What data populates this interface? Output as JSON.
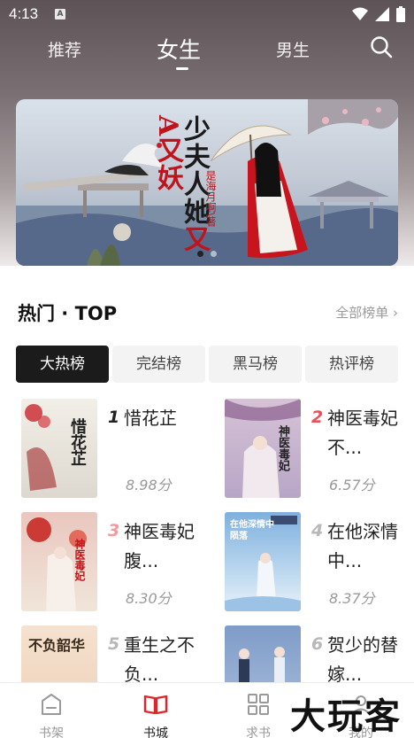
{
  "status_bar": {
    "time": "4:13",
    "notification_icon": "A"
  },
  "top_nav": {
    "tabs": [
      {
        "label": "推荐"
      },
      {
        "label": "女生"
      },
      {
        "label": "男生"
      }
    ],
    "active_tab": "女生"
  },
  "banner": {
    "title_black": "少夫人她",
    "title_red": "又A又妖",
    "author": "是海月啊\\著",
    "slide_count": 2,
    "active_slide": 1
  },
  "hot": {
    "title": "热门 · TOP",
    "all_link": "全部榜单",
    "rank_tabs": [
      {
        "label": "大热榜"
      },
      {
        "label": "完结榜"
      },
      {
        "label": "黑马榜"
      },
      {
        "label": "热评榜"
      }
    ],
    "books": [
      {
        "rank": "1",
        "name": "惜花芷",
        "score": "8.98分",
        "cover_text": "惜花芷"
      },
      {
        "rank": "2",
        "name": "神医毒妃不...",
        "score": "6.57分",
        "cover_text": "神医毒妃"
      },
      {
        "rank": "3",
        "name": "神医毒妃腹...",
        "score": "8.30分",
        "cover_text": "神医毒妃"
      },
      {
        "rank": "4",
        "name": "在他深情中...",
        "score": "8.37分",
        "cover_text": "在他深情中陨落"
      },
      {
        "rank": "5",
        "name": "重生之不负...",
        "score": "",
        "cover_text": "不负韶华"
      },
      {
        "rank": "6",
        "name": "贺少的替嫁...",
        "score": "",
        "cover_text": ""
      }
    ]
  },
  "bottom_nav": {
    "items": [
      {
        "label": "书架",
        "icon": "bookshelf-icon"
      },
      {
        "label": "书城",
        "icon": "open-book-icon"
      },
      {
        "label": "求书",
        "icon": "grid-icon"
      },
      {
        "label": "我的",
        "icon": "profile-icon"
      }
    ],
    "active": "书城"
  },
  "watermark": "大玩客",
  "colors": {
    "accent": "#e0242c",
    "rank_top": "#222222",
    "rank_red": "#e8505a",
    "rank_pink": "#f19aa0",
    "rank_gray": "#b8b8b8"
  }
}
